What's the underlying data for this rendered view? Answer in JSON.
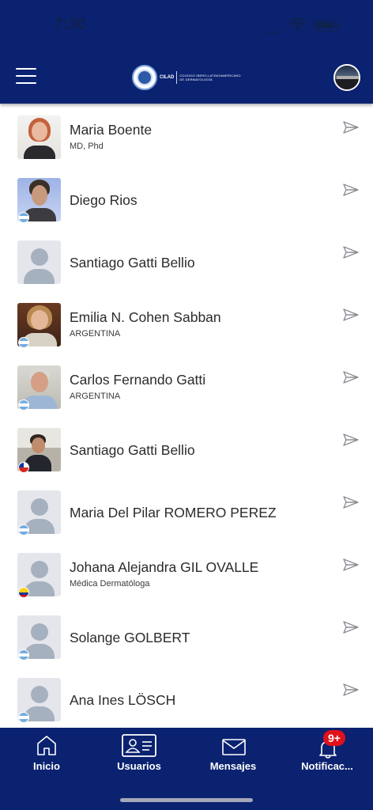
{
  "status_bar": {
    "time": "7:30"
  },
  "header": {
    "logo_short": "CILAD",
    "logo_full": "COLEGIO IBERO-LATINOAMERICANO DE DERMATOLOGÍA",
    "menu_icon": "hamburger-menu-icon",
    "profile_icon": "user-avatar"
  },
  "users": [
    {
      "name": "Maria Boente",
      "subtitle": "MD, Phd",
      "photo": true,
      "flag": ""
    },
    {
      "name": "Diego Rios",
      "subtitle": "",
      "photo": true,
      "flag": "ar"
    },
    {
      "name": "Santiago Gatti Bellio",
      "subtitle": "",
      "photo": false,
      "flag": ""
    },
    {
      "name": "Emilia N. Cohen Sabban",
      "subtitle": "ARGENTINA",
      "photo": true,
      "flag": "ar"
    },
    {
      "name": "Carlos Fernando Gatti",
      "subtitle": "ARGENTINA",
      "photo": true,
      "flag": "ar"
    },
    {
      "name": "Santiago Gatti Bellio",
      "subtitle": "",
      "photo": true,
      "flag": "cl"
    },
    {
      "name": "Maria Del Pilar ROMERO PEREZ",
      "subtitle": "",
      "photo": false,
      "flag": "ar"
    },
    {
      "name": "Johana Alejandra GIL OVALLE",
      "subtitle": "Médica Dermatóloga",
      "photo": false,
      "flag": "co"
    },
    {
      "name": "Solange GOLBERT",
      "subtitle": "",
      "photo": false,
      "flag": "ar"
    },
    {
      "name": "Ana Ines LÖSCH",
      "subtitle": "",
      "photo": false,
      "flag": "ar"
    }
  ],
  "tabbar": {
    "tabs": [
      {
        "label": "Inicio",
        "icon": "home-icon"
      },
      {
        "label": "Usuarios",
        "icon": "users-card-icon"
      },
      {
        "label": "Mensajes",
        "icon": "envelope-icon"
      },
      {
        "label": "Notificac...",
        "icon": "bell-icon"
      }
    ],
    "badge": "9+"
  },
  "colors": {
    "header_bg": "#0b2270",
    "tabbar_bg": "#0b2270",
    "badge_bg": "#e0111b",
    "placeholder_avatar": "#a6b1bf"
  }
}
